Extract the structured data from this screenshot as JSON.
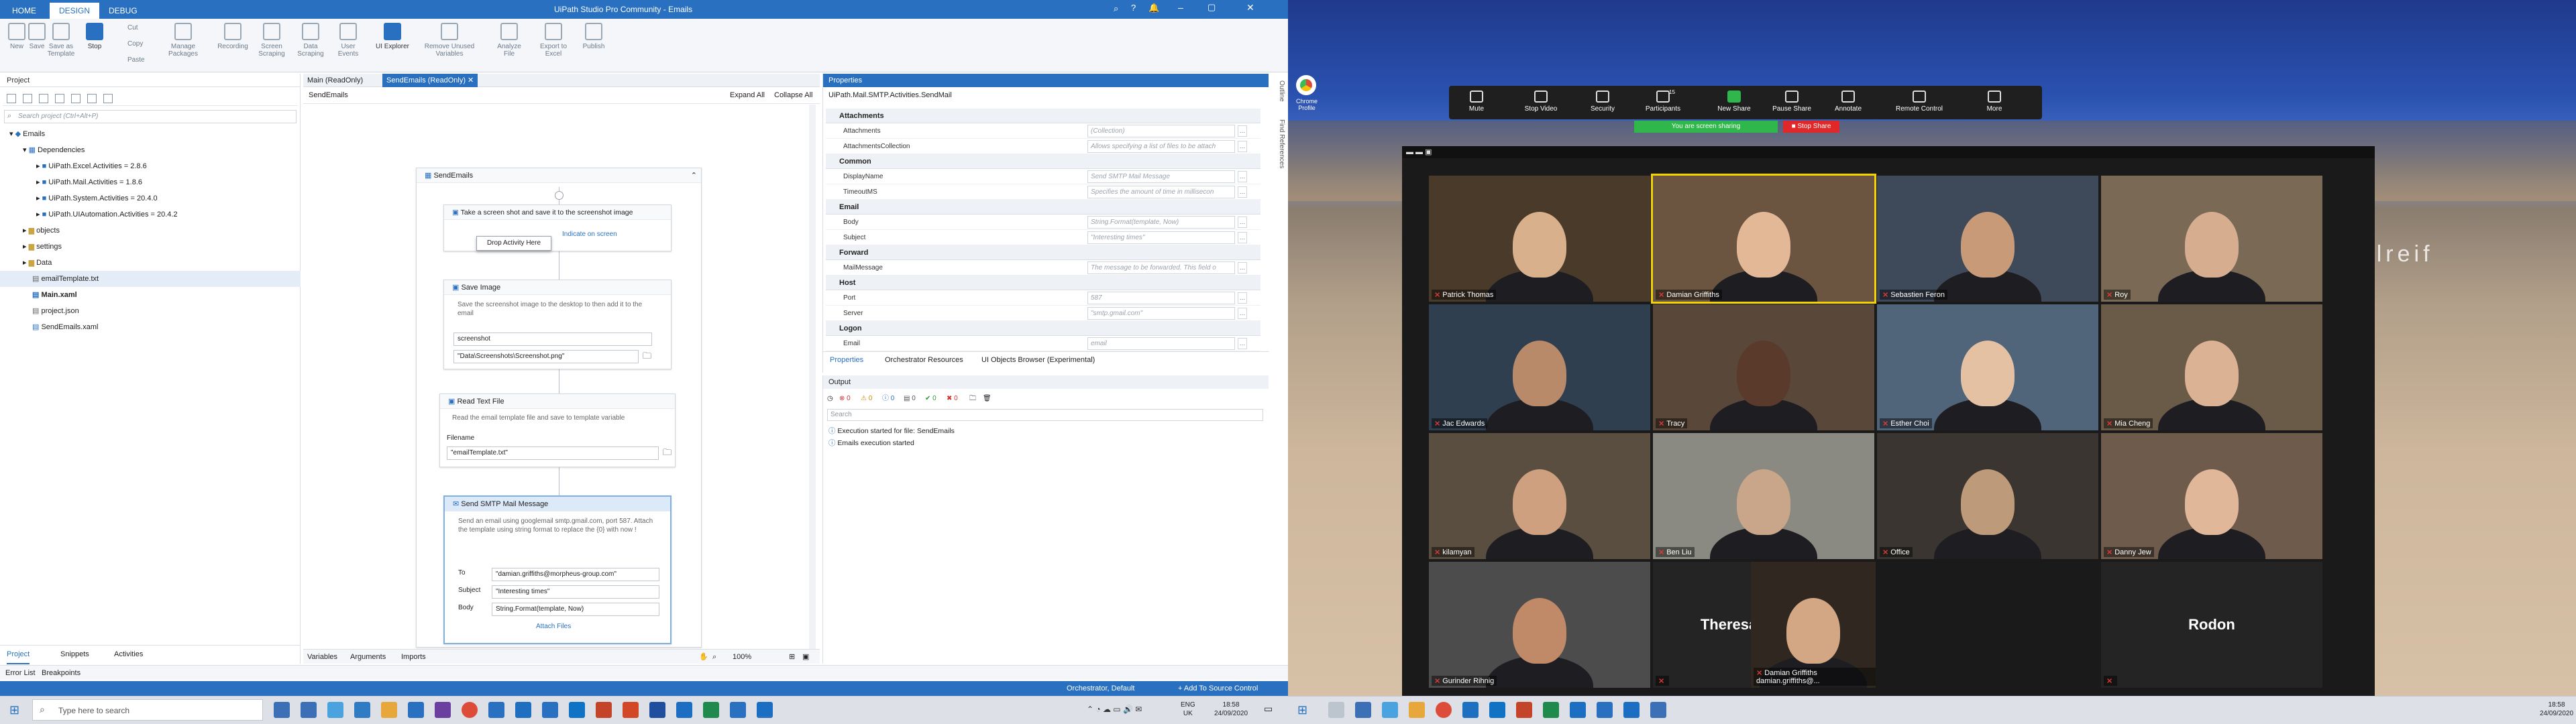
{
  "uipath": {
    "window_title": "UiPath Studio Pro Community - Emails",
    "ribbon_tabs": [
      "HOME",
      "DESIGN",
      "DEBUG"
    ],
    "ribbon_buttons": [
      "New",
      "Save",
      "Save as Template",
      "Stop",
      "Manage Packages",
      "Recording",
      "Screen Scraping",
      "Data Scraping",
      "User Events",
      "UI Explorer",
      "Remove Unused Variables",
      "Analyze File",
      "Export to Excel",
      "Publish"
    ],
    "clipboard": [
      "Cut",
      "Copy",
      "Paste"
    ],
    "project_panel": {
      "title": "Project",
      "search_placeholder": "Search project (Ctrl+Alt+P)",
      "tree": [
        {
          "label": "Emails",
          "level": 0
        },
        {
          "label": "Dependencies",
          "level": 1
        },
        {
          "label": "UiPath.Excel.Activities = 2.8.6",
          "level": 2
        },
        {
          "label": "UiPath.Mail.Activities = 1.8.6",
          "level": 2
        },
        {
          "label": "UiPath.System.Activities = 20.4.0",
          "level": 2
        },
        {
          "label": "UiPath.UIAutomation.Activities = 20.4.2",
          "level": 2
        },
        {
          "label": "objects",
          "level": 1
        },
        {
          "label": "settings",
          "level": 1
        },
        {
          "label": "Data",
          "level": 1
        },
        {
          "label": "emailTemplate.txt",
          "level": 1
        },
        {
          "label": "Main.xaml",
          "level": 1
        },
        {
          "label": "project.json",
          "level": 1
        },
        {
          "label": "SendEmails.xaml",
          "level": 1
        }
      ],
      "bottom_tabs": [
        "Project",
        "Snippets",
        "Activities"
      ],
      "footer_tabs": [
        "Error List",
        "Breakpoints"
      ]
    },
    "designer": {
      "doc_tabs": [
        "Main (ReadOnly)",
        "SendEmails (ReadOnly)"
      ],
      "breadcrumb": "SendEmails",
      "expand_all": "Expand All",
      "collapse_all": "Collapse All",
      "sequence_title": "SendEmails",
      "activity1": {
        "title": "Take a screen shot and save it to the screenshot image",
        "indicate": "Indicate on screen",
        "drop": "Drop Activity Here"
      },
      "activity2": {
        "title": "Save Image",
        "desc": "Save the screenshot image to the desktop to then add it to the email",
        "field1": "screenshot",
        "field2": "\"Data\\Screenshots\\Screenshot.png\""
      },
      "activity3": {
        "title": "Read Text File",
        "desc": "Read the email template file and save to template variable",
        "filename_label": "Filename",
        "filename": "\"emailTemplate.txt\""
      },
      "activity4": {
        "title": "Send SMTP Mail Message",
        "desc": "Send an email using googlemail smtp.gmail.com, port 587. Attach the template using string format to replace the {0} with now !",
        "to_label": "To",
        "to": "\"damian.griffiths@morpheus-group.com\"",
        "subject_label": "Subject",
        "subject": "\"Interesting times\"",
        "body_label": "Body",
        "body": "String.Format(template, Now)",
        "attach": "Attach Files"
      },
      "bottom_tabs": [
        "Variables",
        "Arguments",
        "Imports"
      ],
      "zoom": "100%"
    },
    "properties": {
      "title": "Properties",
      "subtitle": "UiPath.Mail.SMTP.Activities.SendMail",
      "sections": [
        {
          "name": "Attachments",
          "rows": [
            {
              "k": "Attachments",
              "v": "(Collection)"
            },
            {
              "k": "AttachmentsCollection",
              "v": "Allows specifying a list of files to be attach"
            }
          ]
        },
        {
          "name": "Common",
          "rows": [
            {
              "k": "DisplayName",
              "v": "Send SMTP Mail Message"
            },
            {
              "k": "TimeoutMS",
              "v": "Specifies the amount of time in millisecon"
            }
          ]
        },
        {
          "name": "Email",
          "rows": [
            {
              "k": "Body",
              "v": "String.Format(template, Now)"
            },
            {
              "k": "Subject",
              "v": "\"Interesting times\""
            }
          ]
        },
        {
          "name": "Forward",
          "rows": [
            {
              "k": "MailMessage",
              "v": "The message to be forwarded. This field o"
            }
          ]
        },
        {
          "name": "Host",
          "rows": [
            {
              "k": "Port",
              "v": "587"
            },
            {
              "k": "Server",
              "v": "\"smtp.gmail.com\""
            }
          ]
        },
        {
          "name": "Logon",
          "rows": [
            {
              "k": "Email",
              "v": "email"
            }
          ]
        }
      ],
      "bottom_tabs": [
        "Properties",
        "Orchestrator Resources",
        "UI Objects Browser (Experimental)"
      ]
    },
    "side_tabs": [
      "Outline",
      "Find References"
    ],
    "output": {
      "title": "Output",
      "filters": [
        "0",
        "0",
        "0",
        "0",
        "0",
        "0"
      ],
      "search_placeholder": "Search",
      "lines": [
        "Execution started for file: SendEmails",
        "Emails execution started"
      ]
    },
    "statusbar": {
      "orchestrator": "Orchestrator, Default",
      "source_control": "+ Add To Source Control"
    }
  },
  "taskbar_left": {
    "search_placeholder": "Type here to search",
    "lang": "ENG",
    "region": "UK",
    "time": "18:58",
    "date": "24/09/2020"
  },
  "taskbar_right": {
    "time": "18:58",
    "date": "24/09/2020"
  },
  "desktop": {
    "chrome_label": "Chrome Profile",
    "watermark": "paulreif"
  },
  "zoom": {
    "toolbar": [
      "Mute",
      "Stop Video",
      "Security",
      "Participants",
      "New Share",
      "Pause Share",
      "Annotate",
      "Remote Control",
      "More"
    ],
    "participant_count": "15",
    "sharing_text": "You are screen sharing",
    "stop_share": "Stop Share",
    "participants": [
      "Patrick Thomas",
      "Damian Griffiths",
      "Sebastien Feron",
      "Roy",
      "Jac Edwards",
      "Tracy",
      "Esther Choi",
      "Mia Cheng",
      "kilamyan",
      "Ben Liu",
      "Office",
      "Danny Jew",
      "Gurinder Rihnig",
      "Theresa Colema...",
      "Damian Griffiths damian.griffiths@...",
      "Rodon"
    ]
  }
}
